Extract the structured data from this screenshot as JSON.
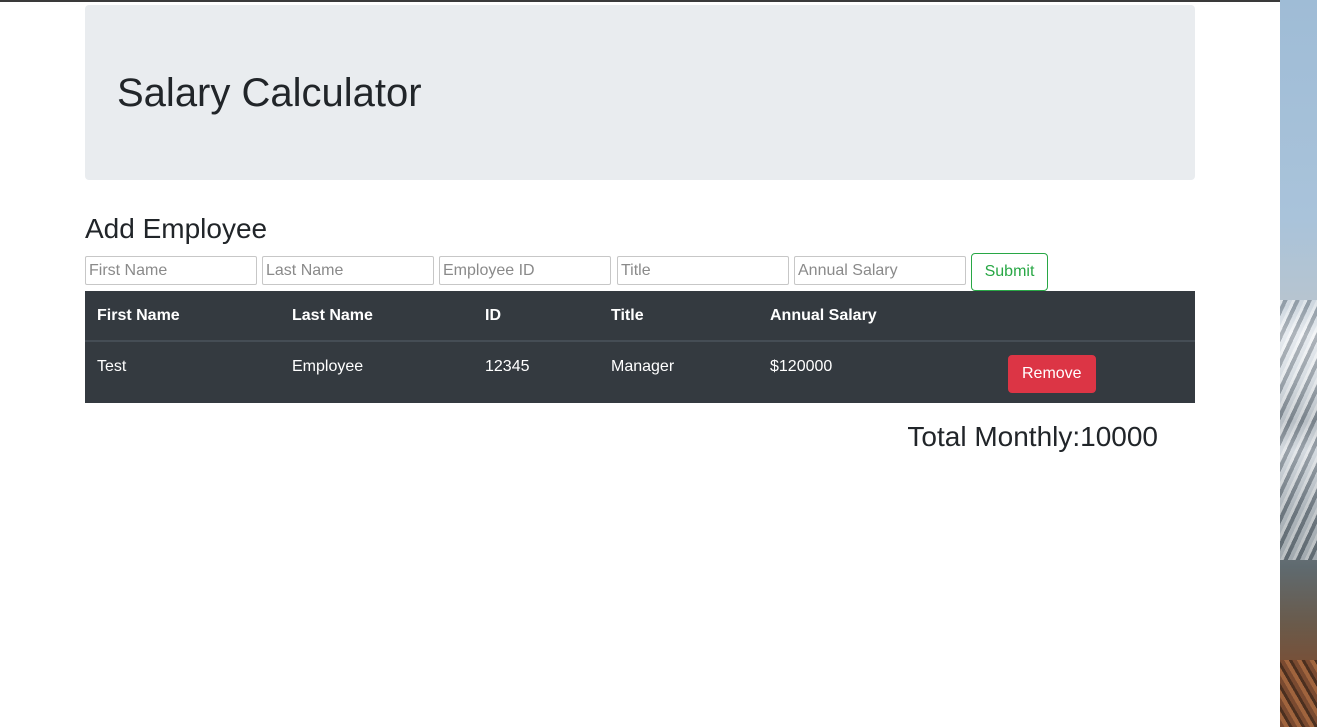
{
  "header": {
    "title": "Salary Calculator"
  },
  "form": {
    "heading": "Add Employee",
    "first_name_placeholder": "First Name",
    "last_name_placeholder": "Last Name",
    "employee_id_placeholder": "Employee ID",
    "title_placeholder": "Title",
    "annual_salary_placeholder": "Annual Salary",
    "submit_label": "Submit"
  },
  "table": {
    "columns": [
      "First Name",
      "Last Name",
      "ID",
      "Title",
      "Annual Salary",
      ""
    ],
    "rows": [
      {
        "first_name": "Test",
        "last_name": "Employee",
        "id": "12345",
        "title": "Manager",
        "annual_salary": "$120000",
        "remove_label": "Remove"
      }
    ]
  },
  "total": {
    "text": "Total Monthly:10000"
  },
  "colors": {
    "jumbotron_bg": "#e9ecef",
    "table_bg": "#343a40",
    "submit_accent": "#28a745",
    "remove_accent": "#dc3545"
  }
}
